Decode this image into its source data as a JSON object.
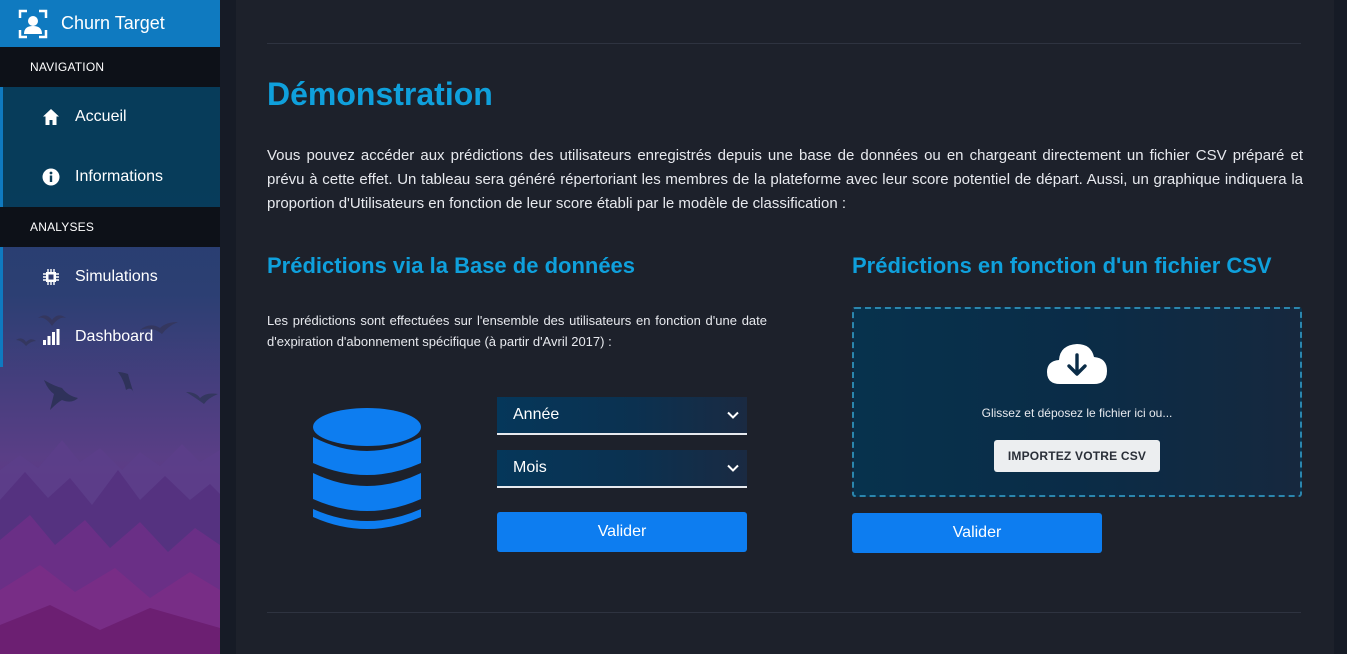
{
  "brand": {
    "title": "Churn Target",
    "icon": "user-target-icon"
  },
  "sidebar": {
    "sections": [
      {
        "header": "NAVIGATION",
        "items": [
          {
            "label": "Accueil",
            "icon": "home-icon"
          },
          {
            "label": "Informations",
            "icon": "info-icon"
          }
        ]
      },
      {
        "header": "ANALYSES",
        "items": [
          {
            "label": "Simulations",
            "icon": "chip-icon"
          },
          {
            "label": "Dashboard",
            "icon": "bar-chart-icon"
          }
        ]
      }
    ]
  },
  "main": {
    "title": "Démonstration",
    "intro": "Vous pouvez accéder aux prédictions des utilisateurs enregistrés depuis une base de données ou en chargeant directement un fichier CSV préparé et prévu à cette effet. Un tableau sera généré répertoriant les membres de la plateforme avec leur score potentiel de départ. Aussi, un graphique indiquera la proportion d'Utilisateurs en fonction de leur score établi par le modèle de classification :",
    "db_section": {
      "title": "Prédictions via la Base de données",
      "description": "Les prédictions sont effectuées sur l'ensemble des utilisateurs en fonction d'une date d'expiration d'abonnement spécifique (à partir d'Avril 2017) :",
      "year_select": "Année",
      "month_select": "Mois",
      "submit_label": "Valider"
    },
    "csv_section": {
      "title": "Prédictions en fonction d'un fichier CSV",
      "drop_text": "Glissez et déposez le fichier ici ou...",
      "import_label": "IMPORTEZ VOTRE CSV",
      "submit_label": "Valider"
    }
  },
  "colors": {
    "accent": "#0fa0dc",
    "primary_button": "#0d7df0",
    "brand_bar": "#0f7ac0",
    "main_bg": "#1d212b"
  }
}
